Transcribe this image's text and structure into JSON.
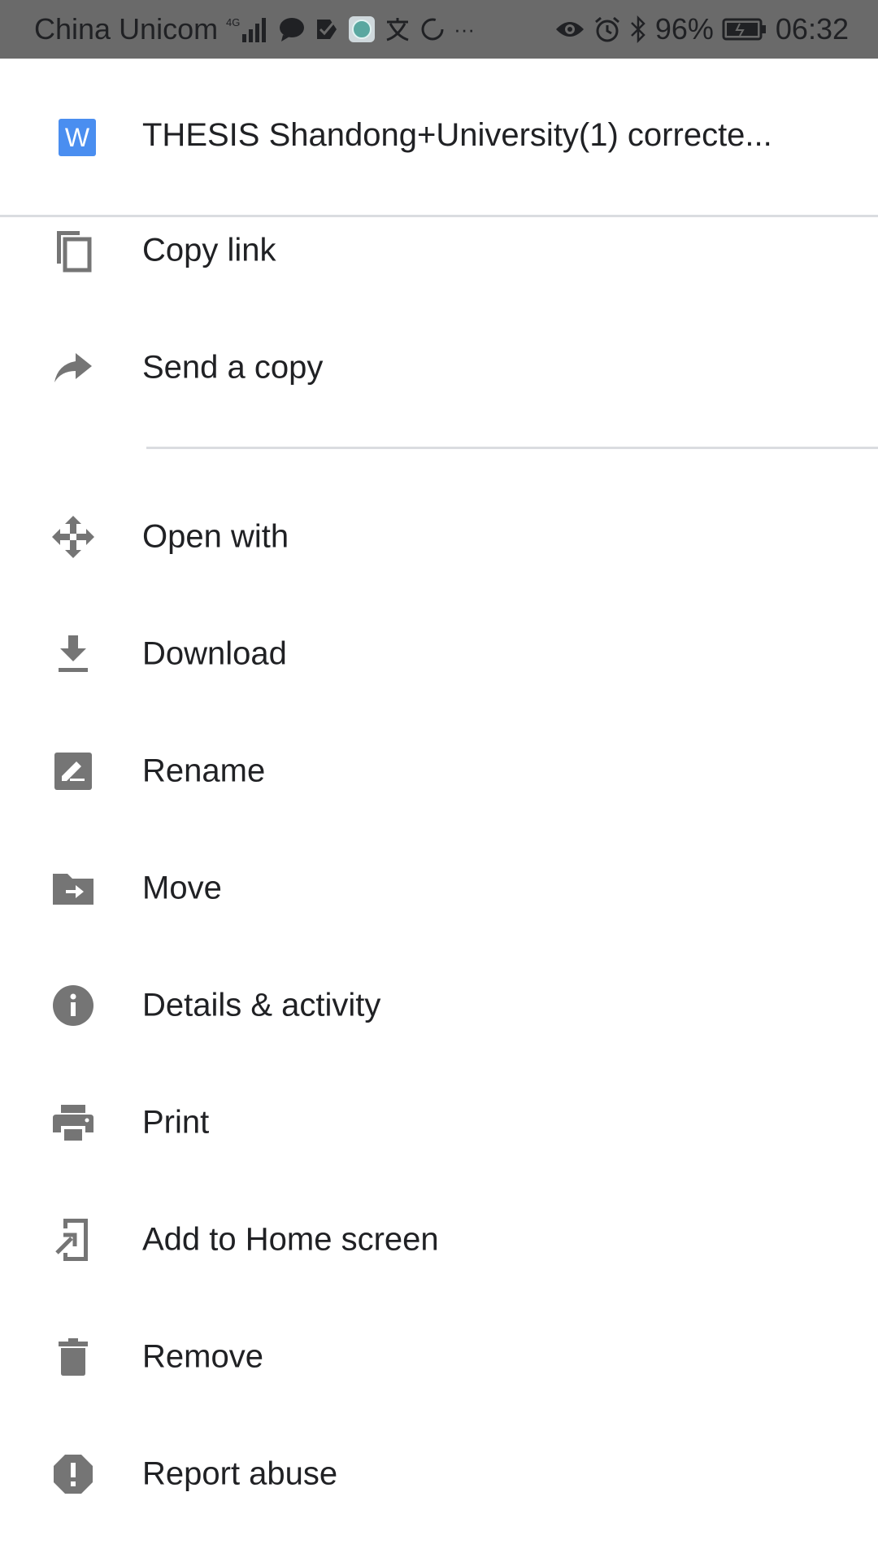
{
  "status_bar": {
    "carrier": "China Unicom",
    "network": "4G",
    "battery": "96%",
    "time": "06:32",
    "more": "···"
  },
  "header": {
    "file_icon_letter": "W",
    "file_name": "THESIS Shandong+University(1) correcte..."
  },
  "menu": {
    "copy_link": "Copy link",
    "send_copy": "Send a copy",
    "open_with": "Open with",
    "download": "Download",
    "rename": "Rename",
    "move": "Move",
    "details": "Details & activity",
    "print": "Print",
    "add_home": "Add to Home screen",
    "remove": "Remove",
    "report": "Report abuse"
  },
  "colors": {
    "status_bar": "#6a6a6a",
    "icon": "#757575",
    "word_icon": "#4a8ef0",
    "text": "#202124",
    "divider": "#dadce0"
  }
}
